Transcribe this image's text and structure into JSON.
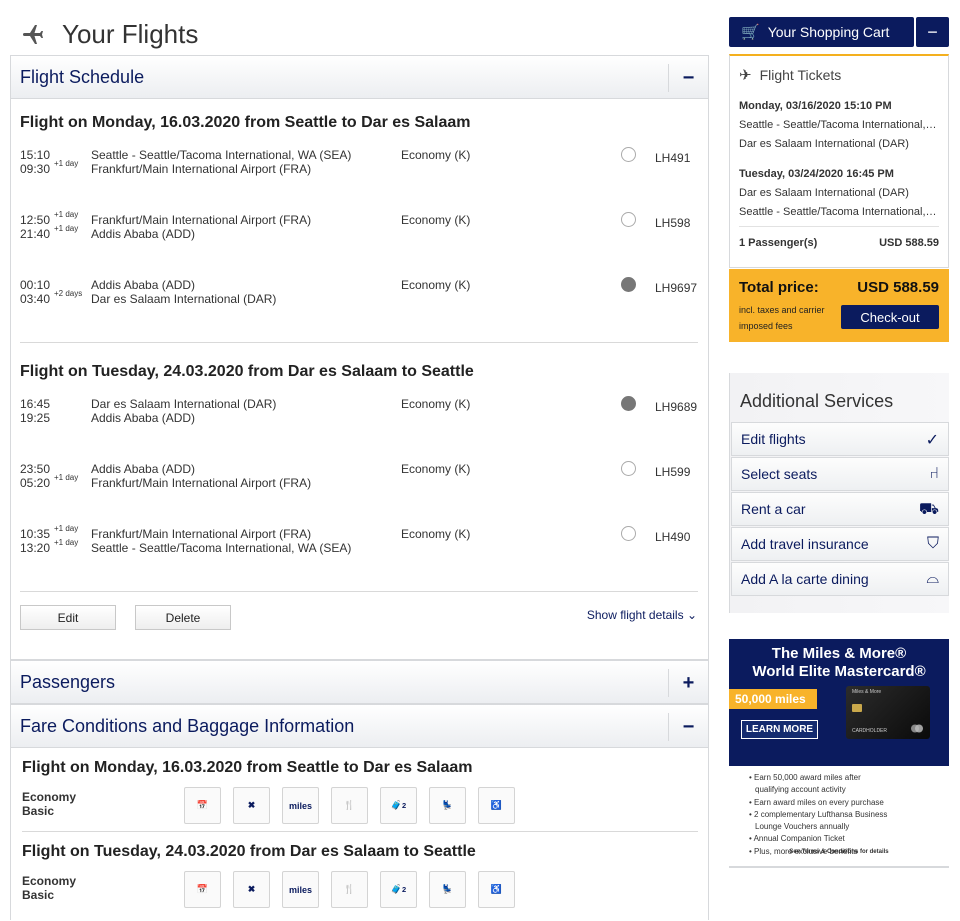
{
  "page": {
    "title": "Your Flights"
  },
  "schedule": {
    "section_title": "Flight Schedule",
    "toggle": "−",
    "outbound": {
      "title": "Flight on Monday, 16.03.2020 from Seattle to Dar es Salaam",
      "segments": [
        {
          "dep_time": "15:10",
          "dep_plus": "",
          "arr_time": "09:30",
          "arr_plus": "+1 day",
          "from": "Seattle - Seattle/Tacoma International, WA (SEA)",
          "to": "Frankfurt/Main International Airport (FRA)",
          "class": "Economy (K)",
          "flight": "LH491",
          "icon": "lufthansa-icon"
        },
        {
          "dep_time": "12:50",
          "dep_plus": "+1 day",
          "arr_time": "21:40",
          "arr_plus": "+1 day",
          "from": "Frankfurt/Main International Airport (FRA)",
          "to": "Addis Ababa (ADD)",
          "class": "Economy (K)",
          "flight": "LH598",
          "icon": "lufthansa-icon"
        },
        {
          "dep_time": "00:10",
          "dep_plus": "",
          "arr_time": "03:40",
          "arr_plus": "+2 days",
          "from": "Addis Ababa (ADD)",
          "to": "Dar es Salaam International (DAR)",
          "class": "Economy (K)",
          "flight": "LH9697",
          "icon": "star-alliance-icon"
        }
      ]
    },
    "return": {
      "title": "Flight on Tuesday, 24.03.2020 from Dar es Salaam to Seattle",
      "segments": [
        {
          "dep_time": "16:45",
          "dep_plus": "",
          "arr_time": "19:25",
          "arr_plus": "",
          "from": "Dar es Salaam International (DAR)",
          "to": "Addis Ababa (ADD)",
          "class": "Economy (K)",
          "flight": "LH9689",
          "icon": "star-alliance-icon"
        },
        {
          "dep_time": "23:50",
          "dep_plus": "",
          "arr_time": "05:20",
          "arr_plus": "+1 day",
          "from": "Addis Ababa (ADD)",
          "to": "Frankfurt/Main International Airport (FRA)",
          "class": "Economy (K)",
          "flight": "LH599",
          "icon": "lufthansa-icon"
        },
        {
          "dep_time": "10:35",
          "dep_plus": "+1 day",
          "arr_time": "13:20",
          "arr_plus": "+1 day",
          "from": "Frankfurt/Main International Airport (FRA)",
          "to": "Seattle - Seattle/Tacoma International, WA (SEA)",
          "class": "Economy (K)",
          "flight": "LH490",
          "icon": "lufthansa-icon"
        }
      ]
    },
    "edit_label": "Edit",
    "delete_label": "Delete",
    "details_label": "Show flight details"
  },
  "passengers": {
    "section_title": "Passengers",
    "toggle": "+"
  },
  "fare": {
    "section_title": "Fare Conditions and Baggage Information",
    "toggle": "−",
    "outbound_title": "Flight on Monday, 16.03.2020 from Seattle to Dar es Salaam",
    "return_title": "Flight on Tuesday, 24.03.2020 from Dar es Salaam to Seattle",
    "class_line1": "Economy",
    "class_line2": "Basic",
    "icons": [
      "rebooking-fee-icon",
      "no-refund-icon",
      "no-miles-icon",
      "meal-icon",
      "baggage-2-icon",
      "seat-fee-icon",
      "accessibility-icon"
    ],
    "miles_text": "miles",
    "baggage_count": "2"
  },
  "cart": {
    "button_label": "Your Shopping Cart",
    "minimize": "−",
    "tickets_title": "Flight Tickets",
    "out_date": "Monday, 03/16/2020 15:10 PM",
    "out_from": "Seattle - Seattle/Tacoma International, WA (SEA)",
    "out_to": "Dar es Salaam International (DAR)",
    "ret_date": "Tuesday, 03/24/2020 16:45 PM",
    "ret_from": "Dar es Salaam International (DAR)",
    "ret_to": "Seattle - Seattle/Tacoma International, WA (SEA)",
    "passengers": "1 Passenger(s)",
    "price": "USD 588.59",
    "total_label": "Total price:",
    "total_amount": "USD 588.59",
    "total_note": "incl. taxes and carrier imposed fees",
    "checkout_label": "Check-out"
  },
  "services": {
    "title": "Additional Services",
    "items": [
      {
        "label": "Edit flights",
        "icon": "check-icon"
      },
      {
        "label": "Select seats",
        "icon": "seat-icon"
      },
      {
        "label": "Rent a car",
        "icon": "car-icon"
      },
      {
        "label": "Add travel insurance",
        "icon": "shield-icon"
      },
      {
        "label": "Add A la carte dining",
        "icon": "dining-cloche-icon"
      }
    ]
  },
  "ad": {
    "line1": "The Miles & More®",
    "line2": "World Elite Mastercard®",
    "miles": "50,000 miles",
    "learn_more": "LEARN MORE",
    "card_brand": "Miles & More",
    "card_holder": "CARDHOLDER",
    "bullets": [
      "• Earn 50,000 award miles after",
      "   qualifying account activity",
      "• Earn award miles on every purchase",
      "• 2 complementary Lufthansa Business",
      "   Lounge Vouchers annually",
      "• Annual Companion Ticket",
      "• Plus, more exclusive benefits"
    ],
    "terms": "See Terms & Conditions for details"
  }
}
